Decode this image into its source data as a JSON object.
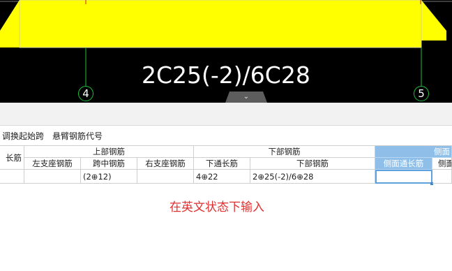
{
  "cad": {
    "annotation": "2C25(-2)/6C28",
    "axis_left": "4",
    "axis_right": "5",
    "collapse_glyph": "⌄",
    "colors": {
      "beam": "#ffff00",
      "grid_line": "#1fbf3a",
      "background": "#000000"
    }
  },
  "toolbar": {
    "swap_start_span": "调换起始跨",
    "cantilever_code": "悬臂钢筋代号"
  },
  "table": {
    "col0_top": "长筋",
    "groups": {
      "top_rebar": "上部钢筋",
      "bottom_rebar": "下部钢筋",
      "side_rebar": "侧面"
    },
    "headers": {
      "left_support": "左支座钢筋",
      "mid_span": "跨中钢筋",
      "right_support": "右支座钢筋",
      "bottom_through": "下通长筋",
      "bottom_rebar": "下部钢筋",
      "side_through": "侧面通长筋",
      "side_other": "侧面"
    },
    "row": {
      "mid_span": "(2⊕12)",
      "bottom_through": "4⊕22",
      "bottom_rebar": "2⊕25(-2)/6⊕28",
      "side_through": ""
    }
  },
  "instruction": "在英文状态下输入"
}
